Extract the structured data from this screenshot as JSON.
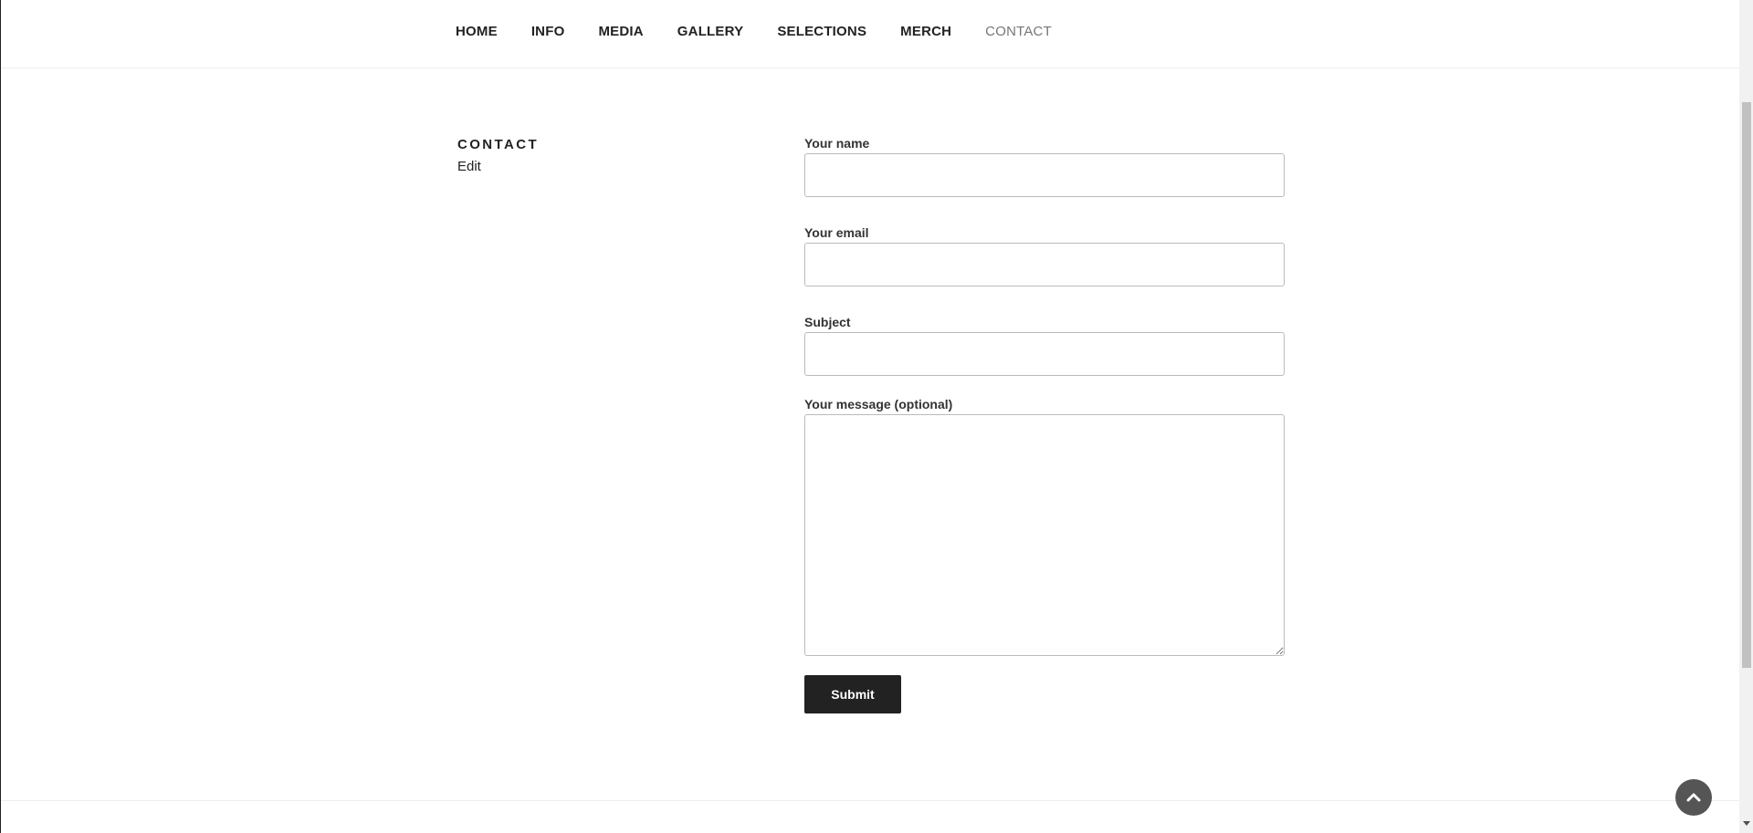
{
  "nav": {
    "items": [
      {
        "label": "HOME"
      },
      {
        "label": "INFO"
      },
      {
        "label": "MEDIA"
      },
      {
        "label": "GALLERY"
      },
      {
        "label": "SELECTIONS"
      },
      {
        "label": "MERCH"
      },
      {
        "label": "CONTACT",
        "current": true
      }
    ]
  },
  "page": {
    "title": "CONTACT",
    "edit_label": "Edit"
  },
  "form": {
    "name_label": "Your name",
    "name_value": "",
    "email_label": "Your email",
    "email_value": "",
    "subject_label": "Subject",
    "subject_value": "",
    "message_label": "Your message (optional)",
    "message_value": "",
    "submit_label": "Submit"
  },
  "icons": {
    "back_to_top": "chevron-up-icon"
  },
  "colors": {
    "text": "#222222",
    "nav_current": "#767676",
    "button_bg": "#222222",
    "back_to_top_bg": "#555555"
  }
}
